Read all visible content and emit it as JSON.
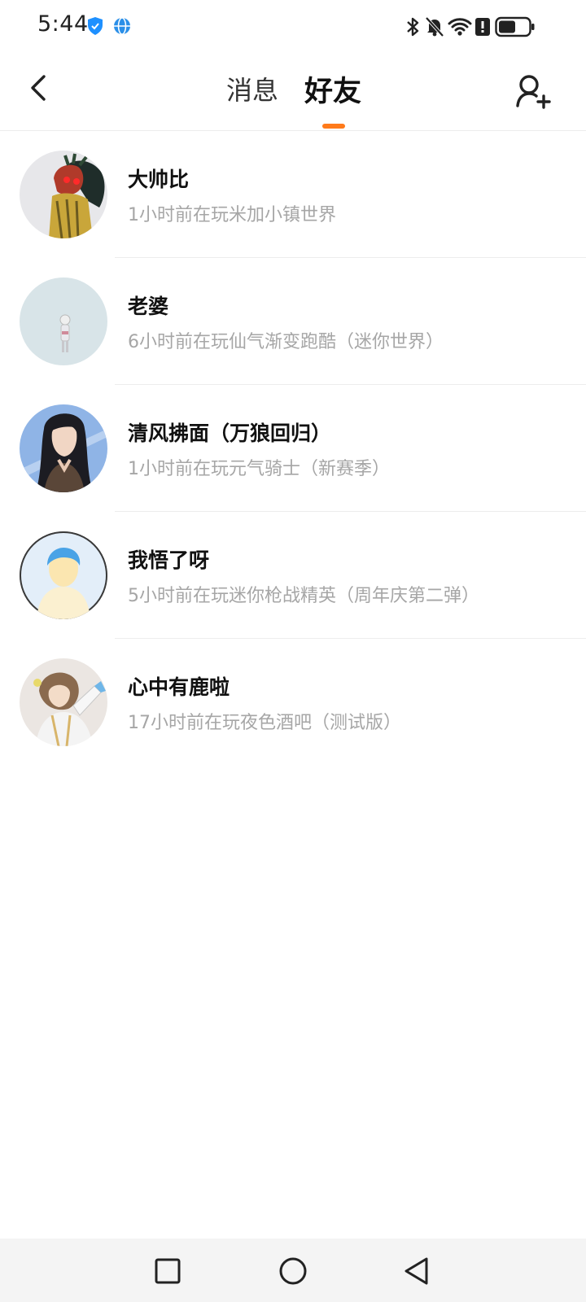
{
  "status_bar": {
    "time": "5:44",
    "icons": [
      "shield-icon",
      "globe-icon",
      "bluetooth-icon",
      "bell-muted-icon",
      "wifi-icon",
      "alert-icon",
      "battery-icon"
    ]
  },
  "header": {
    "tabs": [
      {
        "label": "消息",
        "active": false
      },
      {
        "label": "好友",
        "active": true
      }
    ],
    "accent_color": "#ff7a1a"
  },
  "friends": [
    {
      "name": "大帅比",
      "status": "1小时前在玩米加小镇世界"
    },
    {
      "name": "老婆",
      "status": "6小时前在玩仙气渐变跑酷（迷你世界）"
    },
    {
      "name": "清风拂面（万狼回归）",
      "status": "1小时前在玩元气骑士（新赛季）"
    },
    {
      "name": "我悟了呀",
      "status": "5小时前在玩迷你枪战精英（周年庆第二弹）"
    },
    {
      "name": "心中有鹿啦",
      "status": "17小时前在玩夜色酒吧（测试版）"
    }
  ],
  "nav_bar": {
    "buttons": [
      "recents-square-icon",
      "home-circle-icon",
      "back-triangle-icon"
    ]
  }
}
